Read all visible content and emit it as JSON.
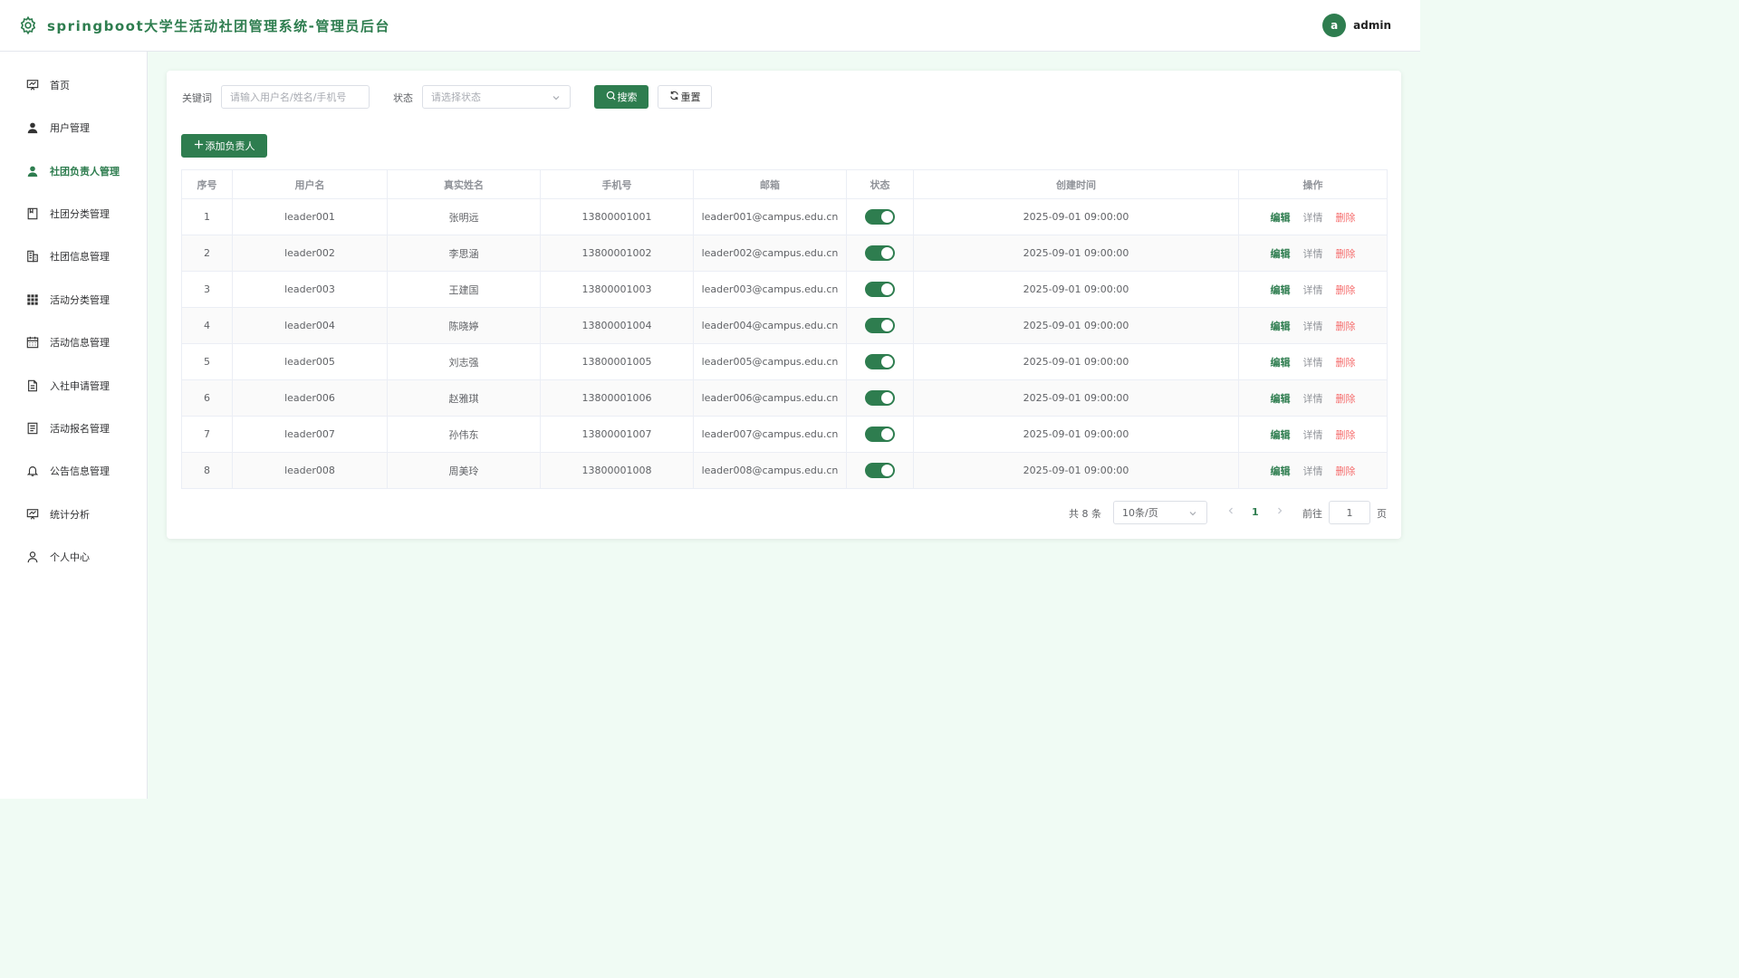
{
  "header": {
    "title": "springboot大学生活动社团管理系统-管理员后台",
    "user": {
      "avatar_letter": "a",
      "name": "admin"
    }
  },
  "sidebar": {
    "items": [
      {
        "label": "首页",
        "icon": "dashboard-icon",
        "active": false
      },
      {
        "label": "用户管理",
        "icon": "user-icon",
        "active": false
      },
      {
        "label": "社团负责人管理",
        "icon": "user-icon",
        "active": true
      },
      {
        "label": "社团分类管理",
        "icon": "category-icon",
        "active": false
      },
      {
        "label": "社团信息管理",
        "icon": "building-icon",
        "active": false
      },
      {
        "label": "活动分类管理",
        "icon": "grid-icon",
        "active": false
      },
      {
        "label": "活动信息管理",
        "icon": "calendar-icon",
        "active": false
      },
      {
        "label": "入社申请管理",
        "icon": "document-icon",
        "active": false
      },
      {
        "label": "活动报名管理",
        "icon": "list-document-icon",
        "active": false
      },
      {
        "label": "公告信息管理",
        "icon": "bell-icon",
        "active": false
      },
      {
        "label": "统计分析",
        "icon": "chart-board-icon",
        "active": false
      },
      {
        "label": "个人中心",
        "icon": "person-outline-icon",
        "active": false
      }
    ]
  },
  "filters": {
    "keyword_label": "关键词",
    "keyword_placeholder": "请输入用户名/姓名/手机号",
    "status_label": "状态",
    "status_placeholder": "请选择状态",
    "search_label": "搜索",
    "reset_label": "重置"
  },
  "toolbar": {
    "add_label": "添加负责人"
  },
  "table": {
    "columns": [
      "序号",
      "用户名",
      "真实姓名",
      "手机号",
      "邮箱",
      "状态",
      "创建时间",
      "操作"
    ],
    "action_labels": {
      "edit": "编辑",
      "detail": "详情",
      "delete": "删除"
    },
    "rows": [
      {
        "index": "1",
        "username": "leader001",
        "real_name": "张明远",
        "phone": "13800001001",
        "email": "leader001@campus.edu.cn",
        "enabled": true,
        "created": "2025-09-01 09:00:00"
      },
      {
        "index": "2",
        "username": "leader002",
        "real_name": "李思涵",
        "phone": "13800001002",
        "email": "leader002@campus.edu.cn",
        "enabled": true,
        "created": "2025-09-01 09:00:00"
      },
      {
        "index": "3",
        "username": "leader003",
        "real_name": "王建国",
        "phone": "13800001003",
        "email": "leader003@campus.edu.cn",
        "enabled": true,
        "created": "2025-09-01 09:00:00"
      },
      {
        "index": "4",
        "username": "leader004",
        "real_name": "陈晓婷",
        "phone": "13800001004",
        "email": "leader004@campus.edu.cn",
        "enabled": true,
        "created": "2025-09-01 09:00:00"
      },
      {
        "index": "5",
        "username": "leader005",
        "real_name": "刘志强",
        "phone": "13800001005",
        "email": "leader005@campus.edu.cn",
        "enabled": true,
        "created": "2025-09-01 09:00:00"
      },
      {
        "index": "6",
        "username": "leader006",
        "real_name": "赵雅琪",
        "phone": "13800001006",
        "email": "leader006@campus.edu.cn",
        "enabled": true,
        "created": "2025-09-01 09:00:00"
      },
      {
        "index": "7",
        "username": "leader007",
        "real_name": "孙伟东",
        "phone": "13800001007",
        "email": "leader007@campus.edu.cn",
        "enabled": true,
        "created": "2025-09-01 09:00:00"
      },
      {
        "index": "8",
        "username": "leader008",
        "real_name": "周美玲",
        "phone": "13800001008",
        "email": "leader008@campus.edu.cn",
        "enabled": true,
        "created": "2025-09-01 09:00:00"
      }
    ]
  },
  "pagination": {
    "total_text": "共 8 条",
    "page_size": "10条/页",
    "current_page": "1",
    "goto_label": "前往",
    "goto_value": "1",
    "page_suffix": "页"
  },
  "colors": {
    "accent": "#2e7d4f",
    "danger": "#f56c6c",
    "background": "#f0fbf4"
  }
}
